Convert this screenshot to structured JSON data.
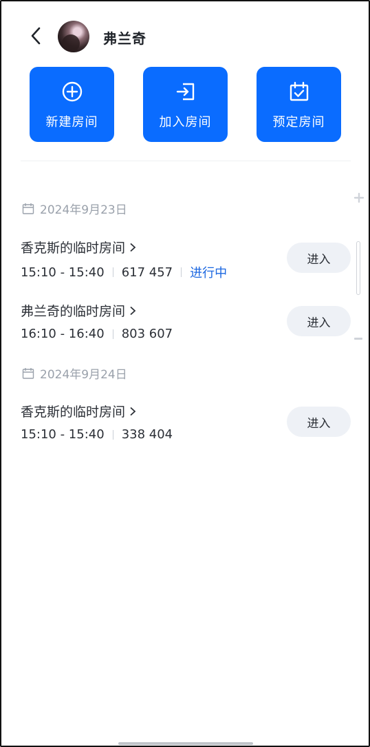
{
  "header": {
    "contact_name": "弗兰奇"
  },
  "actions": [
    {
      "label": "新建房间",
      "icon": "plus-circle-icon"
    },
    {
      "label": "加入房间",
      "icon": "enter-icon"
    },
    {
      "label": "预定房间",
      "icon": "calendar-check-icon"
    }
  ],
  "groups": [
    {
      "date": "2024年9月23日",
      "items": [
        {
          "title": "香克斯的临时房间",
          "time": "15:10 - 15:40",
          "room_id": "617 457",
          "status": "进行中",
          "button": "进入"
        },
        {
          "title": "弗兰奇的临时房间",
          "time": "16:10 - 16:40",
          "room_id": "803 607",
          "status": "",
          "button": "进入"
        }
      ]
    },
    {
      "date": "2024年9月24日",
      "items": [
        {
          "title": "香克斯的临时房间",
          "time": "15:10 - 15:40",
          "room_id": "338 404",
          "status": "",
          "button": "进入"
        }
      ]
    }
  ],
  "colors": {
    "accent": "#0a6cff",
    "status": "#1a66e0",
    "button_bg": "#eef1f6",
    "muted": "#9aa1ab"
  }
}
